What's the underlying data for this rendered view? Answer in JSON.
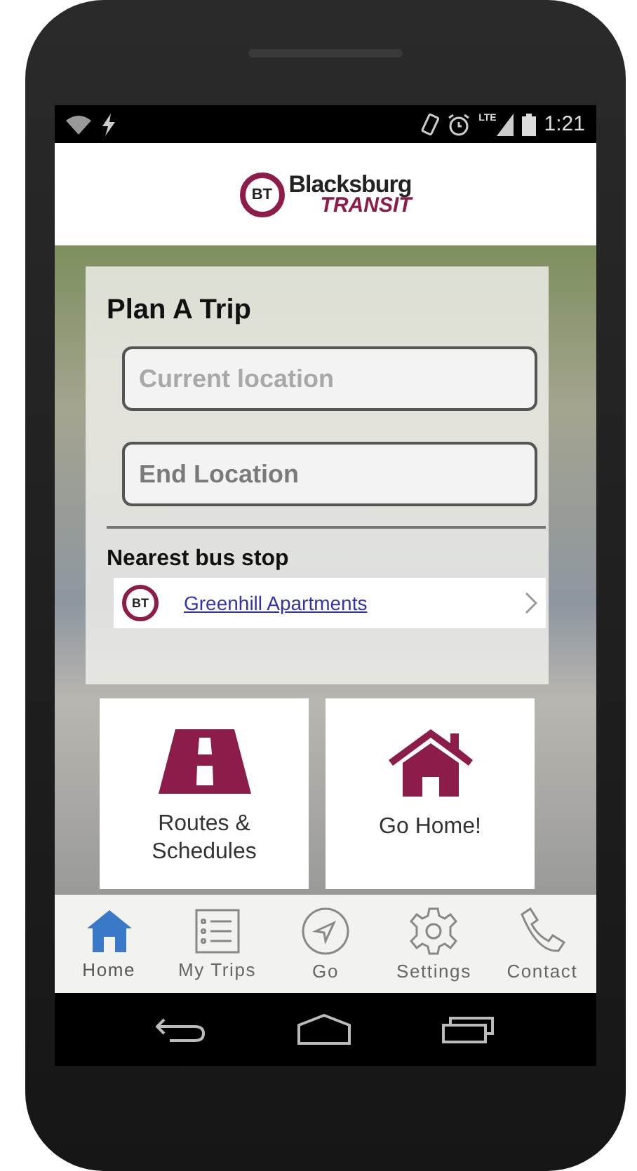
{
  "status_bar": {
    "time": "1:21",
    "network": "LTE"
  },
  "logo": {
    "badge": "BT",
    "name": "Blacksburg",
    "subtitle": "TRANSIT"
  },
  "plan_trip": {
    "title": "Plan A Trip",
    "fields": [
      {
        "placeholder": "Current location"
      },
      {
        "placeholder": "End Location"
      }
    ]
  },
  "nearest_stop": {
    "heading": "Nearest bus stop",
    "badge": "BT",
    "name": "Greenhill Apartments"
  },
  "tiles": [
    {
      "kind": "road",
      "label": "Routes & Schedules"
    },
    {
      "kind": "house",
      "label": "Go Home!"
    }
  ],
  "tabs": [
    {
      "kind": "home",
      "label": "Home",
      "selected": true
    },
    {
      "kind": "list",
      "label": "My Trips",
      "selected": false
    },
    {
      "kind": "navigate",
      "label": "Go",
      "selected": false
    },
    {
      "kind": "gear",
      "label": "Settings",
      "selected": false
    },
    {
      "kind": "phone",
      "label": "Contact",
      "selected": false
    }
  ]
}
